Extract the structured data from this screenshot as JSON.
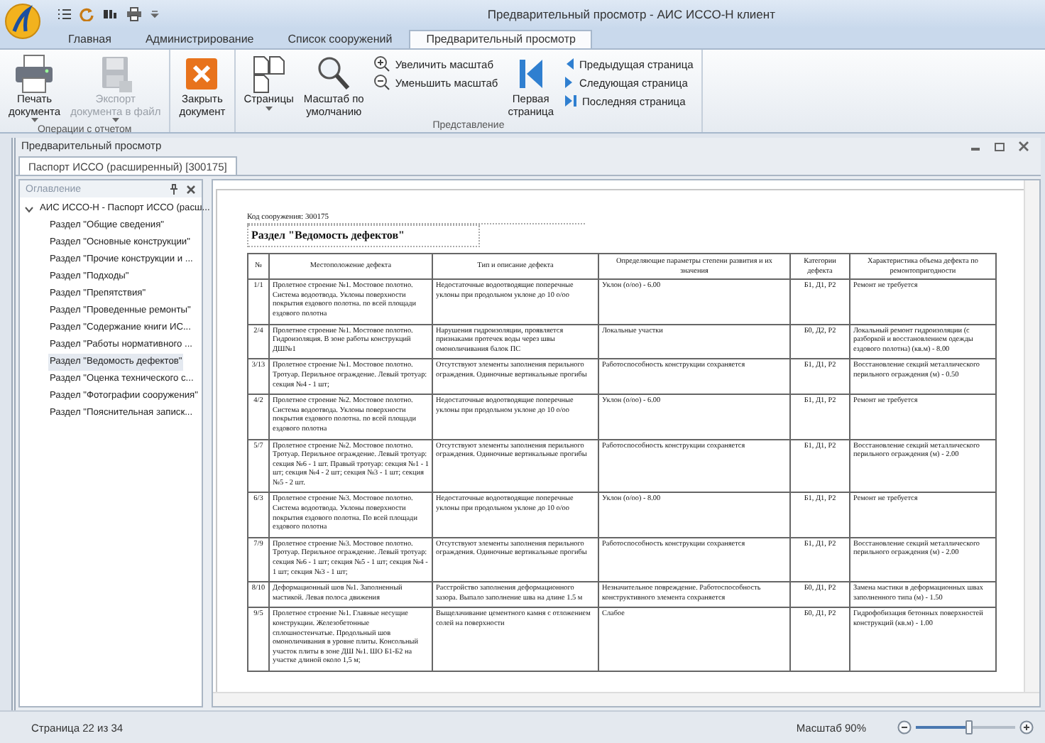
{
  "window": {
    "title": "Предварительный просмотр - АИС ИССО-Н клиент"
  },
  "tabs": [
    {
      "label": "Главная",
      "selected": false
    },
    {
      "label": "Администрирование",
      "selected": false
    },
    {
      "label": "Список сооружений",
      "selected": false
    },
    {
      "label": "Предварительный просмотр",
      "selected": true
    }
  ],
  "ribbon": {
    "groups": [
      {
        "label": "Операции с отчетом",
        "items": [
          {
            "kind": "print",
            "label": "Печать\nдокумента",
            "dropdown": true,
            "disabled": false
          },
          {
            "kind": "export",
            "label": "Экспорт\nдокумента в файл",
            "dropdown": true,
            "disabled": true
          }
        ]
      },
      {
        "items": [
          {
            "kind": "close",
            "label": "Закрыть\nдокумент",
            "dropdown": false,
            "disabled": false
          }
        ]
      },
      {
        "label": "Представление",
        "items": [
          {
            "kind": "pages",
            "label": "Страницы",
            "dropdown": true,
            "disabled": false
          },
          {
            "kind": "zoom",
            "label": "Масштаб по\nумолчанию",
            "dropdown": false,
            "disabled": false
          },
          {
            "kind": "stack",
            "items": [
              {
                "kind": "zoom-in",
                "label": "Увеличить масштаб"
              },
              {
                "kind": "zoom-out",
                "label": "Уменьшить масштаб"
              }
            ]
          },
          {
            "kind": "first",
            "label": "Первая\nстраница",
            "dropdown": false,
            "disabled": false
          },
          {
            "kind": "stack",
            "items": [
              {
                "kind": "prev",
                "label": "Предыдущая страница"
              },
              {
                "kind": "next",
                "label": "Следующая страница"
              },
              {
                "kind": "last",
                "label": "Последняя страница"
              }
            ]
          }
        ]
      }
    ]
  },
  "pane": {
    "title": "Предварительный просмотр",
    "tabs": [
      {
        "label": "Паспорт ИССО (расширенный) [300175]",
        "selected": true
      }
    ]
  },
  "outline": {
    "title": "Оглавление",
    "tree": [
      {
        "label": "АИС ИССО-Н - Паспорт ИССО (расш...",
        "expanded": true,
        "selected": false,
        "children": [
          {
            "label": "Раздел \"Общие сведения\"",
            "selected": false
          },
          {
            "label": "Раздел \"Основные конструкции\"",
            "selected": false
          },
          {
            "label": "Раздел \"Прочие конструкции и ...",
            "selected": false
          },
          {
            "label": "Раздел \"Подходы\"",
            "selected": false
          },
          {
            "label": "Раздел \"Препятствия\"",
            "selected": false
          },
          {
            "label": "Раздел \"Проведенные ремонты\"",
            "selected": false
          },
          {
            "label": "Раздел \"Содержание книги ИС...",
            "selected": false
          },
          {
            "label": "Раздел \"Работы нормативного ...",
            "selected": false
          },
          {
            "label": "Раздел \"Ведомость дефектов\"",
            "selected": true
          },
          {
            "label": "Раздел \"Оценка технического с...",
            "selected": false
          },
          {
            "label": "Раздел \"Фотографии сооружения\"",
            "selected": false
          },
          {
            "label": "Раздел \"Пояснительная записк...",
            "selected": false
          }
        ]
      }
    ]
  },
  "document": {
    "code_line": "Код сооружения: 300175",
    "section_title": "Раздел \"Ведомость дефектов\"",
    "table": {
      "columns": [
        "№",
        "Местоположение дефекта",
        "Тип и описание дефекта",
        "Определяющие параметры степени развития и их значения",
        "Категории дефекта",
        "Характеристика объема дефекта по ремонтопригодности"
      ],
      "rows": [
        [
          "1/1",
          "Пролетное строение №1. Мостовое полотно. Система водоотвода. Уклоны поверхности покрытия ездового полотна. по всей площади ездового полотна",
          "Недостаточные водоотводящие поперечные уклоны при продольном уклоне до 10 о/оо",
          "Уклон (о/оо) - 6.00",
          "Б1, Д1, Р2",
          "Ремонт не требуется"
        ],
        [
          "2/4",
          "Пролетное строение №1. Мостовое полотно. Гидроизоляция. В зоне работы конструкций ДШ№1",
          "Нарушения гидроизоляции, проявляется признаками протечек воды через швы омоноличивания балок ПС",
          "Локальные участки",
          "Б0, Д2, Р2",
          "Локальный ремонт гидроизоляции (с разборкой и восстановлением одежды ездового полотна) (кв.м) - 8.00"
        ],
        [
          "3/13",
          "Пролетное строение №1. Мостовое полотно. Тротуар. Перильное ограждение. Левый тротуар: секция №4 - 1 шт;",
          "Отсутствуют элементы заполнения перильного ограждения. Одиночные вертикальные прогибы",
          "Работоспособность конструкции сохраняется",
          "Б1, Д1, Р2",
          "Восстановление секций металлического перильного ограждения (м) - 0.50"
        ],
        [
          "4/2",
          "Пролетное строение №2. Мостовое полотно. Система водоотвода. Уклоны поверхности покрытия ездового полотна. по всей площади ездового полотна",
          "Недостаточные водоотводящие поперечные уклоны при продольном уклоне до 10 о/оо",
          "Уклон (о/оо) - 6.00",
          "Б1, Д1, Р2",
          "Ремонт не требуется"
        ],
        [
          "5/7",
          "Пролетное строение №2. Мостовое полотно. Тротуар. Перильное ограждение. Левый тротуар: секция №6 - 1 шт. Правый тротуар: секция №1 - 1 шт; секция №4 - 2 шт; секция №3 - 1 шт; секция №5 - 2 шт.",
          "Отсутствуют элементы заполнения перильного ограждения. Одиночные вертикальные прогибы",
          "Работоспособность конструкции сохраняется",
          "Б1, Д1, Р2",
          "Восстановление секций металлического перильного ограждения (м) - 2.00"
        ],
        [
          "6/3",
          "Пролетное строение №3. Мостовое полотно. Система водоотвода. Уклоны поверхности покрытия ездового полотна. По всей площади ездового полотна",
          "Недостаточные водоотводящие поперечные уклоны при продольном уклоне до 10 о/оо",
          "Уклон (о/оо) - 8.00",
          "Б1, Д1, Р2",
          "Ремонт не требуется"
        ],
        [
          "7/9",
          "Пролетное строение №3. Мостовое полотно. Тротуар. Перильное ограждение. Левый тротуар: секция №6 - 1 шт; секция №5 - 1 шт; секция №4 - 1 шт; секция №3 - 1 шт;",
          "Отсутствуют элементы заполнения перильного ограждения. Одиночные вертикальные прогибы",
          "Работоспособность конструкции сохраняется",
          "Б1, Д1, Р2",
          "Восстановление секций металлического перильного ограждения (м) - 2.00"
        ],
        [
          "8/10",
          "Деформационный шов №1. Заполненный мастикой. Левая полоса движения",
          "Расстройство заполнения деформационного зазора. Выпало заполнение шва на длине 1.5 м",
          "Незначительное повреждение. Работоспособность конструктивного элемента сохраняется",
          "Б0, Д1, Р2",
          "Замена мастики в деформационных швах заполненного типа (м) - 1.50"
        ],
        [
          "9/5",
          "Пролетное строение №1. Главные несущие конструкции. Железобетонные сплошностенчатые. Продольный шов омоноличивания в уровне плиты. Консольный участок плиты в зоне ДШ №1. ШО Б1-Б2 на участке длиной около 1,5 м;",
          "Выщелачивание цементного камня с отложением солей на поверхности",
          "Слабое",
          "Б0, Д1, Р2",
          "Гидрофобизация бетонных поверхностей конструкций (кв.м) - 1.00"
        ]
      ]
    }
  },
  "status_bar": {
    "page": "Страница 22 из 34",
    "zoom_label": "Масштаб 90%",
    "zoom": {
      "level": 0.54
    }
  }
}
